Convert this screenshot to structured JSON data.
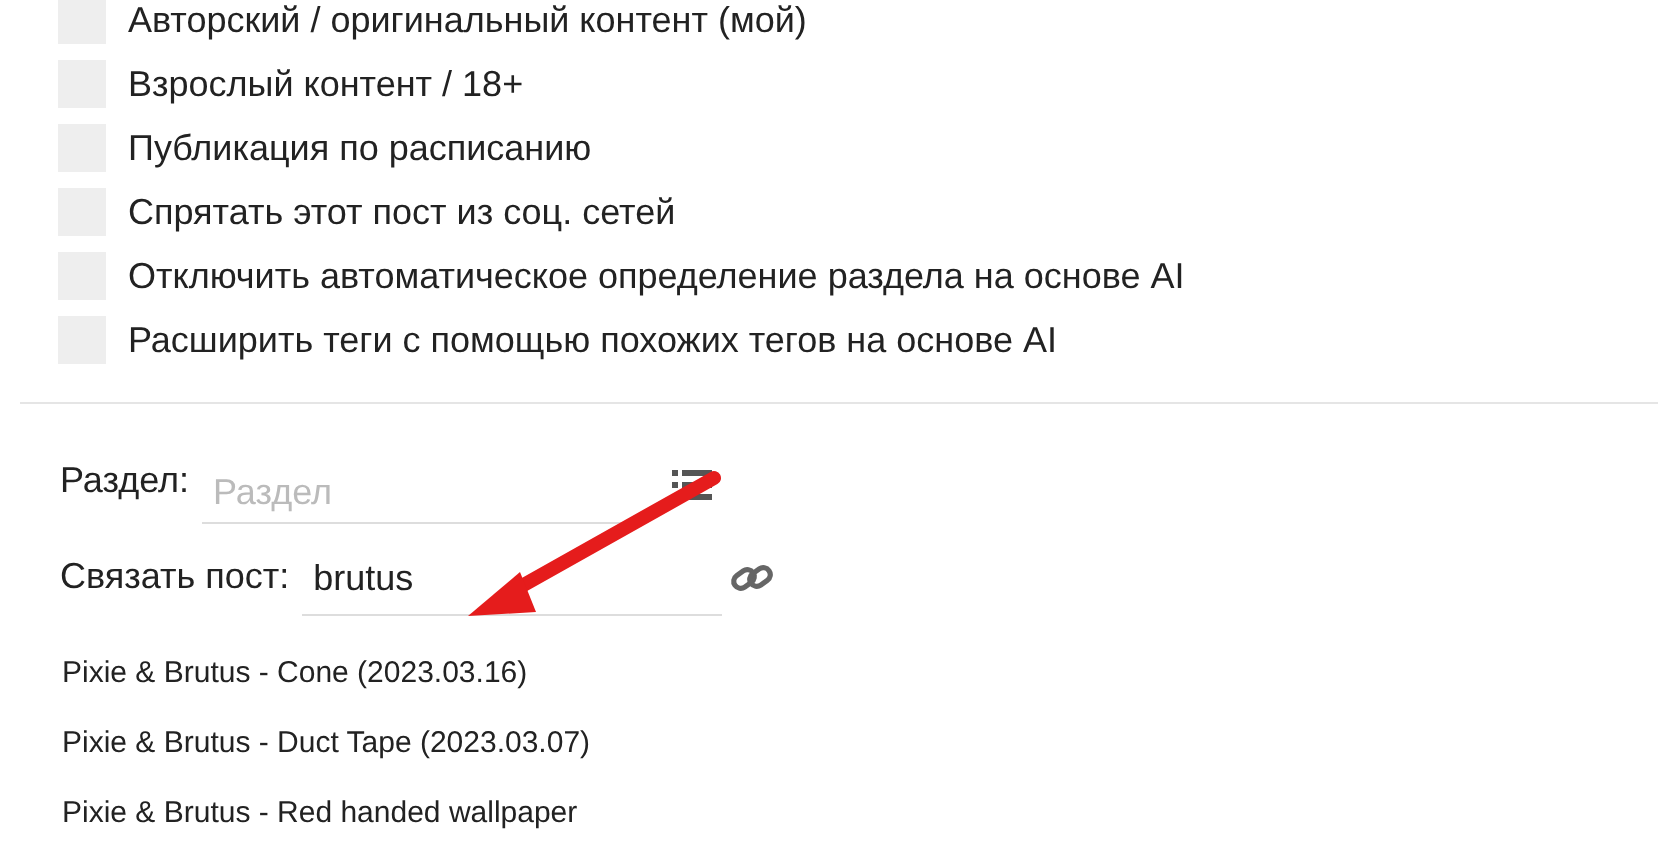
{
  "options": [
    {
      "label": "Авторский / оригинальный контент (мой)",
      "checked": false
    },
    {
      "label": "Взрослый контент / 18+",
      "checked": false
    },
    {
      "label": "Публикация по расписанию",
      "checked": false
    },
    {
      "label": "Спрятать этот пост из соц. сетей",
      "checked": false
    },
    {
      "label": "Отключить автоматическое определение раздела на основе AI",
      "checked": false
    },
    {
      "label": "Расширить теги с помощью похожих тегов на основе AI",
      "checked": false
    }
  ],
  "section": {
    "label": "Раздел:",
    "placeholder": "Раздел"
  },
  "link_post": {
    "label": "Связать пост:",
    "value": "brutus"
  },
  "suggestions": [
    "Pixie & Brutus - Cone (2023.03.16)",
    "Pixie & Brutus - Duct Tape (2023.03.07)",
    "Pixie & Brutus - Red handed wallpaper"
  ]
}
